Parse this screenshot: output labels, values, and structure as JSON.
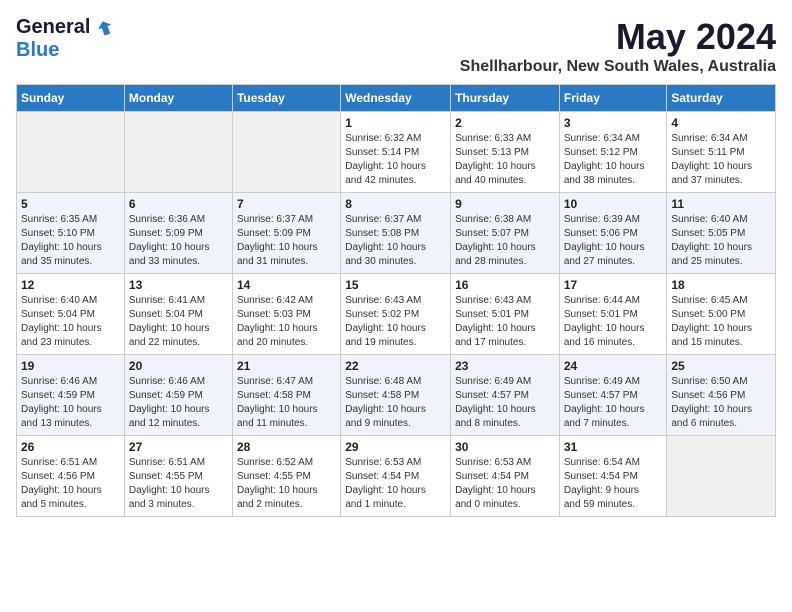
{
  "header": {
    "logo_general": "General",
    "logo_blue": "Blue",
    "month_year": "May 2024",
    "location": "Shellharbour, New South Wales, Australia"
  },
  "weekdays": [
    "Sunday",
    "Monday",
    "Tuesday",
    "Wednesday",
    "Thursday",
    "Friday",
    "Saturday"
  ],
  "weeks": [
    [
      {
        "day": "",
        "info": ""
      },
      {
        "day": "",
        "info": ""
      },
      {
        "day": "",
        "info": ""
      },
      {
        "day": "1",
        "info": "Sunrise: 6:32 AM\nSunset: 5:14 PM\nDaylight: 10 hours\nand 42 minutes."
      },
      {
        "day": "2",
        "info": "Sunrise: 6:33 AM\nSunset: 5:13 PM\nDaylight: 10 hours\nand 40 minutes."
      },
      {
        "day": "3",
        "info": "Sunrise: 6:34 AM\nSunset: 5:12 PM\nDaylight: 10 hours\nand 38 minutes."
      },
      {
        "day": "4",
        "info": "Sunrise: 6:34 AM\nSunset: 5:11 PM\nDaylight: 10 hours\nand 37 minutes."
      }
    ],
    [
      {
        "day": "5",
        "info": "Sunrise: 6:35 AM\nSunset: 5:10 PM\nDaylight: 10 hours\nand 35 minutes."
      },
      {
        "day": "6",
        "info": "Sunrise: 6:36 AM\nSunset: 5:09 PM\nDaylight: 10 hours\nand 33 minutes."
      },
      {
        "day": "7",
        "info": "Sunrise: 6:37 AM\nSunset: 5:09 PM\nDaylight: 10 hours\nand 31 minutes."
      },
      {
        "day": "8",
        "info": "Sunrise: 6:37 AM\nSunset: 5:08 PM\nDaylight: 10 hours\nand 30 minutes."
      },
      {
        "day": "9",
        "info": "Sunrise: 6:38 AM\nSunset: 5:07 PM\nDaylight: 10 hours\nand 28 minutes."
      },
      {
        "day": "10",
        "info": "Sunrise: 6:39 AM\nSunset: 5:06 PM\nDaylight: 10 hours\nand 27 minutes."
      },
      {
        "day": "11",
        "info": "Sunrise: 6:40 AM\nSunset: 5:05 PM\nDaylight: 10 hours\nand 25 minutes."
      }
    ],
    [
      {
        "day": "12",
        "info": "Sunrise: 6:40 AM\nSunset: 5:04 PM\nDaylight: 10 hours\nand 23 minutes."
      },
      {
        "day": "13",
        "info": "Sunrise: 6:41 AM\nSunset: 5:04 PM\nDaylight: 10 hours\nand 22 minutes."
      },
      {
        "day": "14",
        "info": "Sunrise: 6:42 AM\nSunset: 5:03 PM\nDaylight: 10 hours\nand 20 minutes."
      },
      {
        "day": "15",
        "info": "Sunrise: 6:43 AM\nSunset: 5:02 PM\nDaylight: 10 hours\nand 19 minutes."
      },
      {
        "day": "16",
        "info": "Sunrise: 6:43 AM\nSunset: 5:01 PM\nDaylight: 10 hours\nand 17 minutes."
      },
      {
        "day": "17",
        "info": "Sunrise: 6:44 AM\nSunset: 5:01 PM\nDaylight: 10 hours\nand 16 minutes."
      },
      {
        "day": "18",
        "info": "Sunrise: 6:45 AM\nSunset: 5:00 PM\nDaylight: 10 hours\nand 15 minutes."
      }
    ],
    [
      {
        "day": "19",
        "info": "Sunrise: 6:46 AM\nSunset: 4:59 PM\nDaylight: 10 hours\nand 13 minutes."
      },
      {
        "day": "20",
        "info": "Sunrise: 6:46 AM\nSunset: 4:59 PM\nDaylight: 10 hours\nand 12 minutes."
      },
      {
        "day": "21",
        "info": "Sunrise: 6:47 AM\nSunset: 4:58 PM\nDaylight: 10 hours\nand 11 minutes."
      },
      {
        "day": "22",
        "info": "Sunrise: 6:48 AM\nSunset: 4:58 PM\nDaylight: 10 hours\nand 9 minutes."
      },
      {
        "day": "23",
        "info": "Sunrise: 6:49 AM\nSunset: 4:57 PM\nDaylight: 10 hours\nand 8 minutes."
      },
      {
        "day": "24",
        "info": "Sunrise: 6:49 AM\nSunset: 4:57 PM\nDaylight: 10 hours\nand 7 minutes."
      },
      {
        "day": "25",
        "info": "Sunrise: 6:50 AM\nSunset: 4:56 PM\nDaylight: 10 hours\nand 6 minutes."
      }
    ],
    [
      {
        "day": "26",
        "info": "Sunrise: 6:51 AM\nSunset: 4:56 PM\nDaylight: 10 hours\nand 5 minutes."
      },
      {
        "day": "27",
        "info": "Sunrise: 6:51 AM\nSunset: 4:55 PM\nDaylight: 10 hours\nand 3 minutes."
      },
      {
        "day": "28",
        "info": "Sunrise: 6:52 AM\nSunset: 4:55 PM\nDaylight: 10 hours\nand 2 minutes."
      },
      {
        "day": "29",
        "info": "Sunrise: 6:53 AM\nSunset: 4:54 PM\nDaylight: 10 hours\nand 1 minute."
      },
      {
        "day": "30",
        "info": "Sunrise: 6:53 AM\nSunset: 4:54 PM\nDaylight: 10 hours\nand 0 minutes."
      },
      {
        "day": "31",
        "info": "Sunrise: 6:54 AM\nSunset: 4:54 PM\nDaylight: 9 hours\nand 59 minutes."
      },
      {
        "day": "",
        "info": ""
      }
    ]
  ]
}
